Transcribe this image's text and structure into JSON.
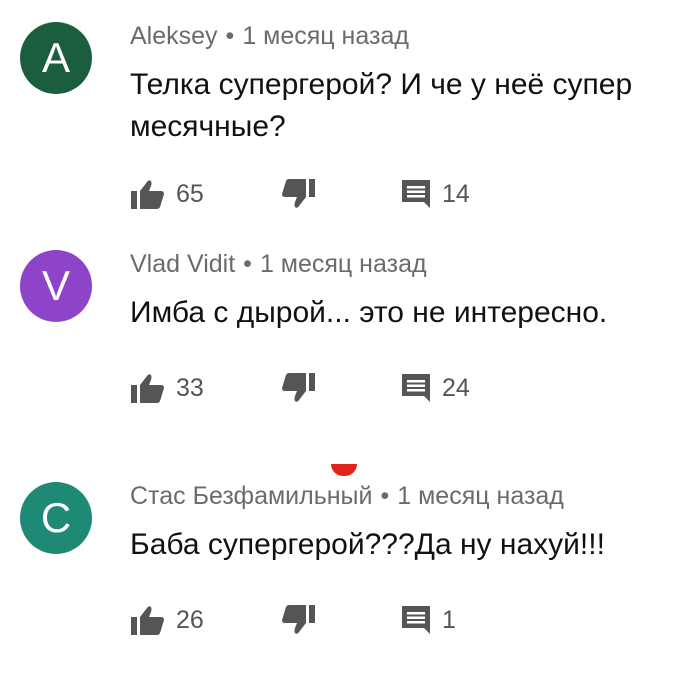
{
  "comments": [
    {
      "avatar_letter": "A",
      "avatar_color": "#1b5e3f",
      "author": "Aleksey",
      "separator": "•",
      "time": "1 месяц назад",
      "text": "Телка супергерой? И че у неё супер месячные?",
      "likes": "65",
      "replies": "14"
    },
    {
      "avatar_letter": "V",
      "avatar_color": "#8e44c9",
      "author": "Vlad Vidit",
      "separator": "•",
      "time": "1 месяц назад",
      "text": "Имба с дырой... это не интересно.",
      "likes": "33",
      "replies": "24"
    },
    {
      "avatar_letter": "C",
      "avatar_color": "#1e8a76",
      "author": "Стас Безфамильный",
      "separator": "•",
      "time": "1 месяц назад",
      "text": "Баба супергерой???Да ну нахуй!!!",
      "likes": "26",
      "replies": "1"
    }
  ],
  "icons": {
    "like": "thumb-up-icon",
    "dislike": "thumb-down-icon",
    "reply": "comment-icon"
  },
  "colors": {
    "icon": "#555555",
    "meta_text": "#6b6b6b",
    "accent_red": "#e0241a"
  }
}
